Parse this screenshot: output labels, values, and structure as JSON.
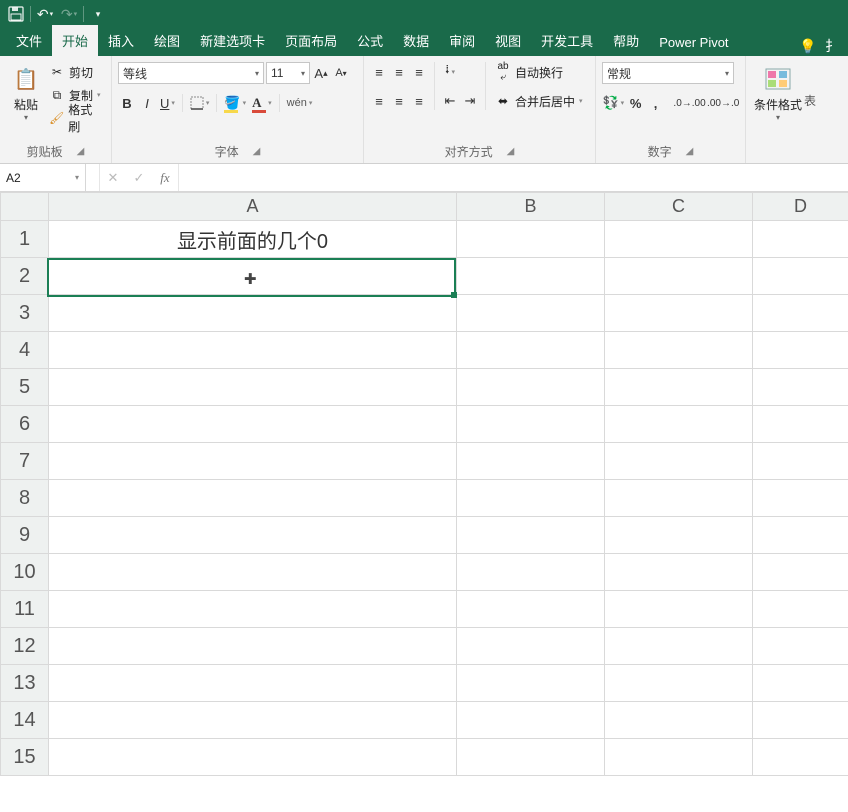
{
  "qat": {
    "save": "💾",
    "undo": "↶",
    "redo": "↷"
  },
  "tabs": {
    "file": "文件",
    "home": "开始",
    "insert": "插入",
    "draw": "绘图",
    "newtab": "新建选项卡",
    "layout": "页面布局",
    "formulas": "公式",
    "data": "数据",
    "review": "审阅",
    "view": "视图",
    "dev": "开发工具",
    "help": "帮助",
    "powerpivot": "Power Pivot"
  },
  "clipboard": {
    "paste": "粘贴",
    "cut": "剪切",
    "copy": "复制",
    "formatpainter": "格式刷",
    "group": "剪贴板"
  },
  "font": {
    "name": "等线",
    "size": "11",
    "group": "字体"
  },
  "align": {
    "wrap": "自动换行",
    "merge": "合并后居中",
    "group": "对齐方式"
  },
  "number": {
    "format": "常规",
    "group": "数字"
  },
  "styles": {
    "condformat": "条件格式",
    "more1": "表",
    "more2": "扌"
  },
  "namebox": "A2",
  "formula": "",
  "columns": [
    "A",
    "B",
    "C",
    "D"
  ],
  "rows": [
    "1",
    "2",
    "3",
    "4",
    "5",
    "6",
    "7",
    "8",
    "9",
    "10",
    "11",
    "12",
    "13",
    "14",
    "15"
  ],
  "cells": {
    "A1": "显示前面的几个0"
  },
  "tell_icon": "💡"
}
